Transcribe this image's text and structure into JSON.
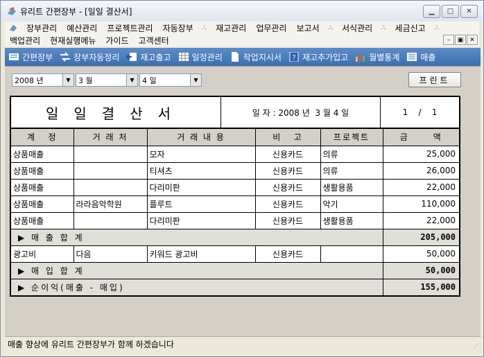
{
  "window": {
    "title": "유리트 간편장부 - [일일 결산서]",
    "minimize": "▁",
    "maximize": "□",
    "close": "✕"
  },
  "menu": {
    "row1": [
      "장부관리",
      "예산관리",
      "프로젝트관리",
      "자동장부",
      "재고관리",
      "업무관리",
      "보고서",
      "서식관리",
      "세금신고"
    ],
    "row2": [
      "백업관리",
      "현재실행메뉴",
      "가이드",
      "고객센터"
    ],
    "sep": "∴",
    "mdi_min": "–",
    "mdi_restore": "▣",
    "mdi_close": "✕"
  },
  "toolbar": {
    "items": [
      {
        "label": "간편장부",
        "icon": "ledger-icon"
      },
      {
        "label": "장부자동정리",
        "icon": "auto-sort-icon"
      },
      {
        "label": "재고출고",
        "icon": "stock-out-icon"
      },
      {
        "label": "일정관리",
        "icon": "calendar-icon"
      },
      {
        "label": "작업지시서",
        "icon": "document-icon"
      },
      {
        "label": "재고추가입고",
        "icon": "help-icon"
      },
      {
        "label": "월별통계",
        "icon": "chart-icon"
      },
      {
        "label": "매출",
        "icon": "list-icon"
      }
    ]
  },
  "filters": {
    "year": "2008 년",
    "month": "3 월",
    "day": "4 일",
    "print_label": "프린트"
  },
  "report": {
    "title": "일일결산서",
    "date_label": "일 자 : 2008 년  3 월 4 일",
    "page": "1    /    1",
    "columns": [
      "계   정",
      "거 래 처",
      "거 래 내 용",
      "비   고",
      "프로젝트",
      "금      액"
    ],
    "sales_rows": [
      {
        "account": "상품매출",
        "client": "",
        "detail": "모자",
        "note": "신용카드",
        "project": "의류",
        "amount": "25,000"
      },
      {
        "account": "상품매출",
        "client": "",
        "detail": "티셔츠",
        "note": "신용카드",
        "project": "의류",
        "amount": "26,000"
      },
      {
        "account": "상품매출",
        "client": "",
        "detail": "다리미판",
        "note": "신용카드",
        "project": "생활용품",
        "amount": "22,000"
      },
      {
        "account": "상품매출",
        "client": "라라음악학원",
        "detail": "플루트",
        "note": "신용카드",
        "project": "악기",
        "amount": "110,000"
      },
      {
        "account": "상품매출",
        "client": "",
        "detail": "다리미판",
        "note": "신용카드",
        "project": "생활용품",
        "amount": "22,000"
      }
    ],
    "sales_total_label": "▶ 매 출 합 계",
    "sales_total": "205,000",
    "purchase_rows": [
      {
        "account": "광고비",
        "client": "다음",
        "detail": "키워드 광고비",
        "note": "신용카드",
        "project": "",
        "amount": "50,000"
      }
    ],
    "purchase_total_label": "▶ 매 입 합 계",
    "purchase_total": "50,000",
    "net_label": "▶ 순이익(매출 - 매입)",
    "net_total": "155,000"
  },
  "status": {
    "message": "매출 향상에 유리트 간편장부가 함께 하겠습니다"
  }
}
